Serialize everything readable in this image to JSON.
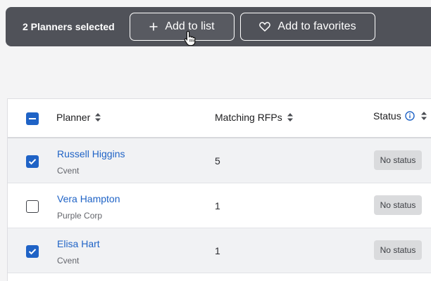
{
  "toolbar": {
    "selection_text": "2 Planners selected",
    "add_to_list_label": "Add to list",
    "add_to_favorites_label": "Add to favorites"
  },
  "table": {
    "columns": {
      "planner": "Planner",
      "matching_rfps": "Matching RFPs",
      "status": "Status"
    },
    "select_all_state": "indeterminate",
    "rows": [
      {
        "name": "Russell Higgins",
        "organization": "Cvent",
        "matching_rfps": "5",
        "status": "No status",
        "checked": true
      },
      {
        "name": "Vera Hampton",
        "organization": "Purple Corp",
        "matching_rfps": "1",
        "status": "No status",
        "checked": false
      },
      {
        "name": "Elisa Hart",
        "organization": "Cvent",
        "matching_rfps": "1",
        "status": "No status",
        "checked": true
      }
    ]
  },
  "colors": {
    "accent": "#1f63c6",
    "toolbar_bg": "#505259",
    "badge_bg": "#dadbdd"
  },
  "icons": [
    "plus-icon",
    "heart-icon",
    "pointer-cursor-icon",
    "sort-icon",
    "info-icon",
    "checkbox-checked-icon",
    "checkbox-indeterminate-icon"
  ]
}
